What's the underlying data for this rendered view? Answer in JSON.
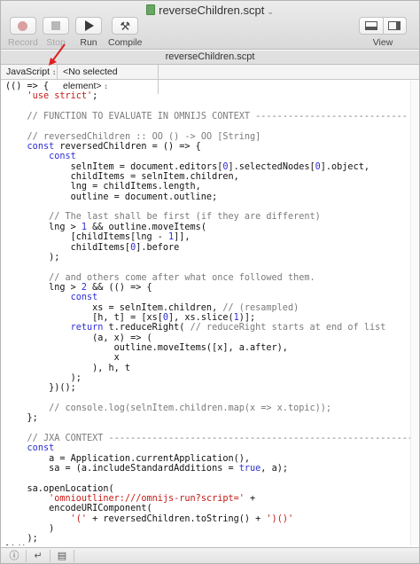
{
  "window": {
    "title": "reverseChildren.scpt",
    "tab_title": "reverseChildren.scpt"
  },
  "toolbar": {
    "record_label": "Record",
    "stop_label": "Stop",
    "run_label": "Run",
    "compile_label": "Compile",
    "view_label": "View"
  },
  "navbar": {
    "language": "JavaScript",
    "element": "<No selected element>"
  },
  "colors": {
    "keyword": "#2d2dd6",
    "string": "#c41a16",
    "comment": "#7a7a7a",
    "annotation_arrow": "#e02020"
  },
  "code": [
    [
      [
        "t",
        "(() => {"
      ]
    ],
    [
      [
        "t",
        "    "
      ],
      [
        "s",
        "'use strict'"
      ],
      [
        "t",
        ";"
      ]
    ],
    [
      [
        "t",
        ""
      ]
    ],
    [
      [
        "t",
        "    "
      ],
      [
        "c",
        "// FUNCTION TO EVALUATE IN OMNIJS CONTEXT ----------------------------"
      ]
    ],
    [
      [
        "t",
        ""
      ]
    ],
    [
      [
        "t",
        "    "
      ],
      [
        "c",
        "// reversedChildren :: OO () -> OO [String]"
      ]
    ],
    [
      [
        "t",
        "    "
      ],
      [
        "k",
        "const"
      ],
      [
        "t",
        " reversedChildren = () => {"
      ]
    ],
    [
      [
        "t",
        "        "
      ],
      [
        "k",
        "const"
      ]
    ],
    [
      [
        "t",
        "            selnItem = document.editors["
      ],
      [
        "k",
        "0"
      ],
      [
        "t",
        "].selectedNodes["
      ],
      [
        "k",
        "0"
      ],
      [
        "t",
        "].object,"
      ]
    ],
    [
      [
        "t",
        "            childItems = selnItem.children,"
      ]
    ],
    [
      [
        "t",
        "            lng = childItems.length,"
      ]
    ],
    [
      [
        "t",
        "            outline = document.outline;"
      ]
    ],
    [
      [
        "t",
        ""
      ]
    ],
    [
      [
        "t",
        "        "
      ],
      [
        "c",
        "// The last shall be first (if they are different)"
      ]
    ],
    [
      [
        "t",
        "        lng > "
      ],
      [
        "k",
        "1"
      ],
      [
        "t",
        " && outline.moveItems("
      ]
    ],
    [
      [
        "t",
        "            [childItems[lng - "
      ],
      [
        "k",
        "1"
      ],
      [
        "t",
        "]],"
      ]
    ],
    [
      [
        "t",
        "            childItems["
      ],
      [
        "k",
        "0"
      ],
      [
        "t",
        "].before"
      ]
    ],
    [
      [
        "t",
        "        );"
      ]
    ],
    [
      [
        "t",
        ""
      ]
    ],
    [
      [
        "t",
        "        "
      ],
      [
        "c",
        "// and others come after what once followed them."
      ]
    ],
    [
      [
        "t",
        "        lng > "
      ],
      [
        "k",
        "2"
      ],
      [
        "t",
        " && (() => {"
      ]
    ],
    [
      [
        "t",
        "            "
      ],
      [
        "k",
        "const"
      ]
    ],
    [
      [
        "t",
        "                xs = selnItem.children, "
      ],
      [
        "c",
        "// (resampled)"
      ]
    ],
    [
      [
        "t",
        "                [h, t] = [xs["
      ],
      [
        "k",
        "0"
      ],
      [
        "t",
        "], xs.slice("
      ],
      [
        "k",
        "1"
      ],
      [
        "t",
        ")];"
      ]
    ],
    [
      [
        "t",
        "            "
      ],
      [
        "k",
        "return"
      ],
      [
        "t",
        " t.reduceRight( "
      ],
      [
        "c",
        "// reduceRight starts at end of list"
      ]
    ],
    [
      [
        "t",
        "                (a, x) => ("
      ]
    ],
    [
      [
        "t",
        "                    outline.moveItems([x], a.after),"
      ]
    ],
    [
      [
        "t",
        "                    x"
      ]
    ],
    [
      [
        "t",
        "                ), h, t"
      ]
    ],
    [
      [
        "t",
        "            );"
      ]
    ],
    [
      [
        "t",
        "        })();"
      ]
    ],
    [
      [
        "t",
        ""
      ]
    ],
    [
      [
        "t",
        "        "
      ],
      [
        "c",
        "// console.log(selnItem.children.map(x => x.topic));"
      ]
    ],
    [
      [
        "t",
        "    };"
      ]
    ],
    [
      [
        "t",
        ""
      ]
    ],
    [
      [
        "t",
        "    "
      ],
      [
        "c",
        "// JXA CONTEXT ---------------------------------------------------------"
      ]
    ],
    [
      [
        "t",
        "    "
      ],
      [
        "k",
        "const"
      ]
    ],
    [
      [
        "t",
        "        a = Application.currentApplication(),"
      ]
    ],
    [
      [
        "t",
        "        sa = (a.includeStandardAdditions = "
      ],
      [
        "k",
        "true"
      ],
      [
        "t",
        ", a);"
      ]
    ],
    [
      [
        "t",
        ""
      ]
    ],
    [
      [
        "t",
        "    sa.openLocation("
      ]
    ],
    [
      [
        "t",
        "        "
      ],
      [
        "s",
        "'omnioutliner:///omnijs-run?script='"
      ],
      [
        "t",
        " +"
      ]
    ],
    [
      [
        "t",
        "        encodeURIComponent("
      ]
    ],
    [
      [
        "t",
        "            "
      ],
      [
        "s",
        "'('"
      ],
      [
        "t",
        " + reversedChildren.toString() + "
      ],
      [
        "s",
        "')()'"
      ]
    ],
    [
      [
        "t",
        "        )"
      ]
    ],
    [
      [
        "t",
        "    );"
      ]
    ],
    [
      [
        "t",
        "})();"
      ]
    ]
  ]
}
